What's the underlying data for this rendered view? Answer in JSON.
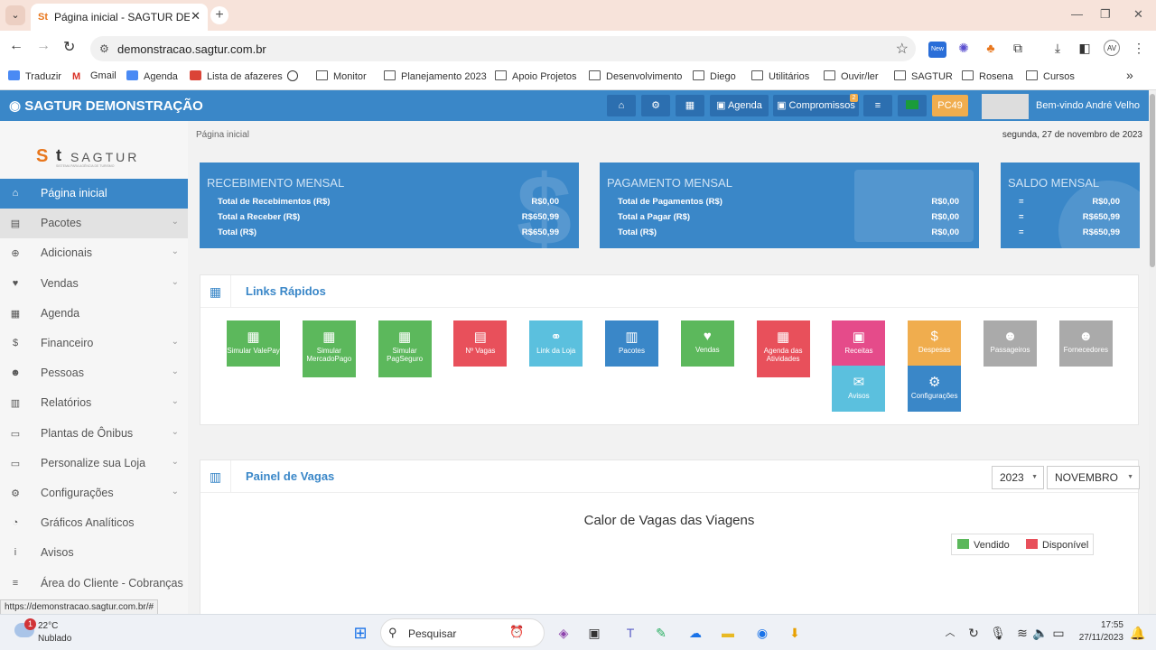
{
  "browser": {
    "tab_title": "Página inicial - SAGTUR DEMONSTRAÇÃO",
    "url": "demonstracao.sagtur.com.br",
    "status_url": "https://demonstracao.sagtur.com.br/#",
    "new_badge": "New",
    "bookmarks": [
      "Traduzir",
      "Gmail",
      "Agenda",
      "Lista de afazeres",
      "Monitor",
      "Planejamento 2023",
      "Apoio Projetos",
      "Desenvolvimento",
      "Diego",
      "Utilitários",
      "Ouvir/ler",
      "SAGTUR",
      "Rosena",
      "Cursos"
    ]
  },
  "app": {
    "brand": "SAGTUR DEMONSTRAÇÃO",
    "logo_text": "SAGTUR",
    "logo_sub": "SISTEMA PARA AGÊNCIA DE TURISMO",
    "nav": {
      "agenda": "Agenda",
      "compromissos": "Compromissos",
      "badge": "2",
      "pc": "PC49",
      "welcome": "Bem-vindo André Velho"
    },
    "sidebar": [
      {
        "label": "Página inicial",
        "icon": "home-icon",
        "chevron": false
      },
      {
        "label": "Pacotes",
        "icon": "map-icon",
        "chevron": true
      },
      {
        "label": "Adicionais",
        "icon": "plus-circle-icon",
        "chevron": true
      },
      {
        "label": "Vendas",
        "icon": "heart-icon",
        "chevron": true
      },
      {
        "label": "Agenda",
        "icon": "calendar-icon",
        "chevron": false
      },
      {
        "label": "Financeiro",
        "icon": "dollar-icon",
        "chevron": true
      },
      {
        "label": "Pessoas",
        "icon": "users-icon",
        "chevron": true
      },
      {
        "label": "Relatórios",
        "icon": "bar-chart-icon",
        "chevron": true
      },
      {
        "label": "Plantas de Ônibus",
        "icon": "bus-icon",
        "chevron": true
      },
      {
        "label": "Personalize sua Loja",
        "icon": "desktop-icon",
        "chevron": true
      },
      {
        "label": "Configurações",
        "icon": "cogs-icon",
        "chevron": true
      },
      {
        "label": "Gráficos Analíticos",
        "icon": "pie-chart-icon",
        "chevron": false
      },
      {
        "label": "Avisos",
        "icon": "info-icon",
        "chevron": false
      },
      {
        "label": "Área do Cliente - Cobranças",
        "icon": "list-icon",
        "chevron": false
      }
    ],
    "breadcrumb": "Página inicial",
    "date": "segunda, 27 de novembro de 2023",
    "cards": [
      {
        "title": "RECEBIMENTO MENSAL",
        "rows": [
          [
            "Total de Recebimentos (R$)",
            "R$0,00"
          ],
          [
            "Total a Receber (R$)",
            "R$650,99"
          ],
          [
            "Total (R$)",
            "R$650,99"
          ]
        ]
      },
      {
        "title": "PAGAMENTO MENSAL",
        "rows": [
          [
            "Total de Pagamentos (R$)",
            "R$0,00"
          ],
          [
            "Total a Pagar (R$)",
            "R$0,00"
          ],
          [
            "Total (R$)",
            "R$0,00"
          ]
        ]
      },
      {
        "title": "SALDO MENSAL",
        "rows": [
          [
            "=",
            "R$0,00"
          ],
          [
            "=",
            "R$650,99"
          ],
          [
            "=",
            "R$650,99"
          ]
        ]
      }
    ],
    "quick_links_title": "Links Rápidos",
    "quick_links": [
      {
        "label": "Simular ValePay",
        "color": "#5cb85c",
        "icon": "calculator-icon",
        "glyph": "▦"
      },
      {
        "label": "Simular MercadoPago",
        "color": "#5cb85c",
        "icon": "calculator-icon",
        "glyph": "▦"
      },
      {
        "label": "Simular PagSeguro",
        "color": "#5cb85c",
        "icon": "calculator-icon",
        "glyph": "▦"
      },
      {
        "label": "Nº Vagas",
        "color": "#e8505b",
        "icon": "table-icon",
        "glyph": "▤"
      },
      {
        "label": "Link da Loja",
        "color": "#5bc0de",
        "icon": "link-icon",
        "glyph": "⚭"
      },
      {
        "label": "Pacotes",
        "color": "#3a87c8",
        "icon": "barcode-icon",
        "glyph": "▥"
      },
      {
        "label": "Vendas",
        "color": "#5cb85c",
        "icon": "heart-icon",
        "glyph": "♥"
      },
      {
        "label": "Agenda das Atividades",
        "color": "#e8505b",
        "icon": "calendar-icon",
        "glyph": "▦"
      },
      {
        "label": "Receitas",
        "color": "#e54b8a",
        "icon": "money-icon",
        "glyph": "▣"
      },
      {
        "label": "Despesas",
        "color": "#f0ad4e",
        "icon": "dollar-icon",
        "glyph": "$"
      },
      {
        "label": "Passageiros",
        "color": "#aaaaaa",
        "icon": "users-icon",
        "glyph": "☻"
      },
      {
        "label": "Fornecedores",
        "color": "#aaaaaa",
        "icon": "users-icon",
        "glyph": "☻"
      },
      {
        "label": "Avisos",
        "color": "#5bc0de",
        "icon": "comments-icon",
        "glyph": "✉"
      },
      {
        "label": "Configurações",
        "color": "#3a87c8",
        "icon": "cogs-icon",
        "glyph": "⚙"
      }
    ],
    "vagas": {
      "title": "Painel de Vagas",
      "year": "2023",
      "month": "NOVEMBRO",
      "chart_title": "Calor de Vagas das Viagens",
      "legend": [
        "Vendido",
        "Disponível"
      ],
      "legend_colors": [
        "#5cb85c",
        "#e8505b"
      ]
    }
  },
  "taskbar": {
    "weather_temp": "22°C",
    "weather_desc": "Nublado",
    "weather_badge": "1",
    "search": "Pesquisar",
    "time": "17:55",
    "date": "27/11/2023"
  }
}
